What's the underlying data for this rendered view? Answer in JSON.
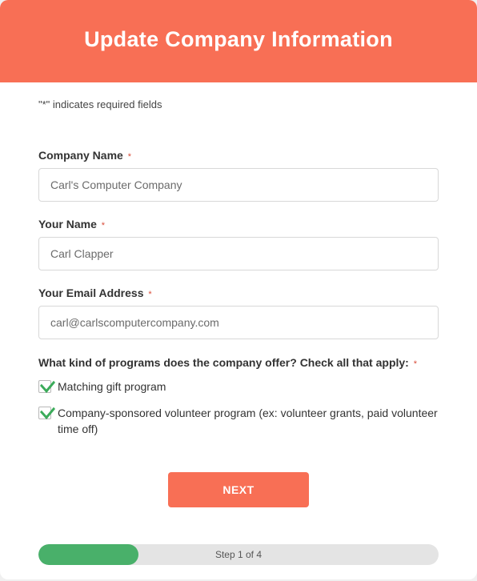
{
  "header": {
    "title": "Update Company Information"
  },
  "note": "\"*\" indicates required fields",
  "fields": {
    "company_name": {
      "label": "Company Name",
      "required": "*",
      "value": "Carl's Computer Company"
    },
    "your_name": {
      "label": "Your Name",
      "required": "*",
      "value": "Carl Clapper"
    },
    "email": {
      "label": "Your Email Address",
      "required": "*",
      "value": "carl@carlscomputercompany.com"
    }
  },
  "programs": {
    "label": "What kind of programs does the company offer? Check all that apply:",
    "required": "*",
    "options": [
      {
        "text": "Matching gift program",
        "checked": true
      },
      {
        "text": "Company-sponsored volunteer program (ex: volunteer grants, paid volunteer time off)",
        "checked": true
      }
    ]
  },
  "next_label": "NEXT",
  "progress": {
    "text": "Step 1 of 4",
    "percent": 25
  }
}
